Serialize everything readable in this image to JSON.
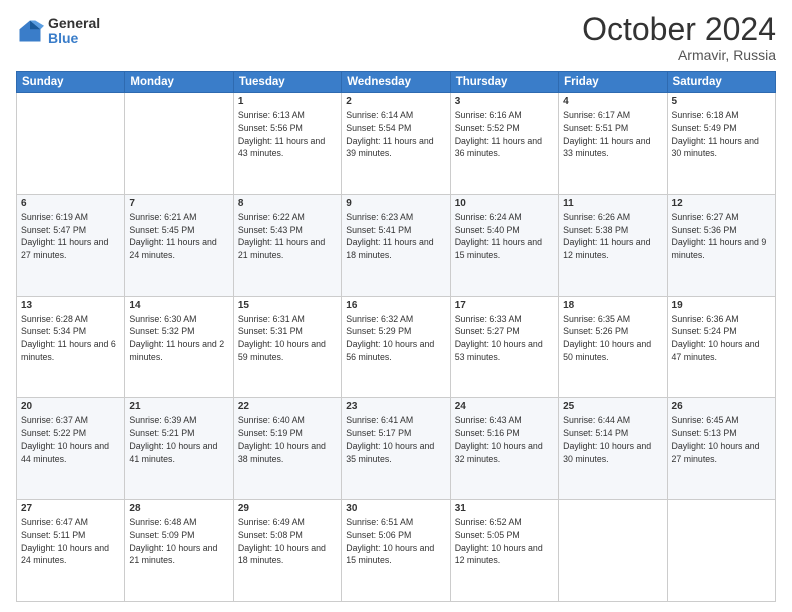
{
  "header": {
    "logo_general": "General",
    "logo_blue": "Blue",
    "month_title": "October 2024",
    "location": "Armavir, Russia"
  },
  "weekdays": [
    "Sunday",
    "Monday",
    "Tuesday",
    "Wednesday",
    "Thursday",
    "Friday",
    "Saturday"
  ],
  "weeks": [
    [
      {
        "day": null,
        "sunrise": null,
        "sunset": null,
        "daylight": null
      },
      {
        "day": null,
        "sunrise": null,
        "sunset": null,
        "daylight": null
      },
      {
        "day": "1",
        "sunrise": "Sunrise: 6:13 AM",
        "sunset": "Sunset: 5:56 PM",
        "daylight": "Daylight: 11 hours and 43 minutes."
      },
      {
        "day": "2",
        "sunrise": "Sunrise: 6:14 AM",
        "sunset": "Sunset: 5:54 PM",
        "daylight": "Daylight: 11 hours and 39 minutes."
      },
      {
        "day": "3",
        "sunrise": "Sunrise: 6:16 AM",
        "sunset": "Sunset: 5:52 PM",
        "daylight": "Daylight: 11 hours and 36 minutes."
      },
      {
        "day": "4",
        "sunrise": "Sunrise: 6:17 AM",
        "sunset": "Sunset: 5:51 PM",
        "daylight": "Daylight: 11 hours and 33 minutes."
      },
      {
        "day": "5",
        "sunrise": "Sunrise: 6:18 AM",
        "sunset": "Sunset: 5:49 PM",
        "daylight": "Daylight: 11 hours and 30 minutes."
      }
    ],
    [
      {
        "day": "6",
        "sunrise": "Sunrise: 6:19 AM",
        "sunset": "Sunset: 5:47 PM",
        "daylight": "Daylight: 11 hours and 27 minutes."
      },
      {
        "day": "7",
        "sunrise": "Sunrise: 6:21 AM",
        "sunset": "Sunset: 5:45 PM",
        "daylight": "Daylight: 11 hours and 24 minutes."
      },
      {
        "day": "8",
        "sunrise": "Sunrise: 6:22 AM",
        "sunset": "Sunset: 5:43 PM",
        "daylight": "Daylight: 11 hours and 21 minutes."
      },
      {
        "day": "9",
        "sunrise": "Sunrise: 6:23 AM",
        "sunset": "Sunset: 5:41 PM",
        "daylight": "Daylight: 11 hours and 18 minutes."
      },
      {
        "day": "10",
        "sunrise": "Sunrise: 6:24 AM",
        "sunset": "Sunset: 5:40 PM",
        "daylight": "Daylight: 11 hours and 15 minutes."
      },
      {
        "day": "11",
        "sunrise": "Sunrise: 6:26 AM",
        "sunset": "Sunset: 5:38 PM",
        "daylight": "Daylight: 11 hours and 12 minutes."
      },
      {
        "day": "12",
        "sunrise": "Sunrise: 6:27 AM",
        "sunset": "Sunset: 5:36 PM",
        "daylight": "Daylight: 11 hours and 9 minutes."
      }
    ],
    [
      {
        "day": "13",
        "sunrise": "Sunrise: 6:28 AM",
        "sunset": "Sunset: 5:34 PM",
        "daylight": "Daylight: 11 hours and 6 minutes."
      },
      {
        "day": "14",
        "sunrise": "Sunrise: 6:30 AM",
        "sunset": "Sunset: 5:32 PM",
        "daylight": "Daylight: 11 hours and 2 minutes."
      },
      {
        "day": "15",
        "sunrise": "Sunrise: 6:31 AM",
        "sunset": "Sunset: 5:31 PM",
        "daylight": "Daylight: 10 hours and 59 minutes."
      },
      {
        "day": "16",
        "sunrise": "Sunrise: 6:32 AM",
        "sunset": "Sunset: 5:29 PM",
        "daylight": "Daylight: 10 hours and 56 minutes."
      },
      {
        "day": "17",
        "sunrise": "Sunrise: 6:33 AM",
        "sunset": "Sunset: 5:27 PM",
        "daylight": "Daylight: 10 hours and 53 minutes."
      },
      {
        "day": "18",
        "sunrise": "Sunrise: 6:35 AM",
        "sunset": "Sunset: 5:26 PM",
        "daylight": "Daylight: 10 hours and 50 minutes."
      },
      {
        "day": "19",
        "sunrise": "Sunrise: 6:36 AM",
        "sunset": "Sunset: 5:24 PM",
        "daylight": "Daylight: 10 hours and 47 minutes."
      }
    ],
    [
      {
        "day": "20",
        "sunrise": "Sunrise: 6:37 AM",
        "sunset": "Sunset: 5:22 PM",
        "daylight": "Daylight: 10 hours and 44 minutes."
      },
      {
        "day": "21",
        "sunrise": "Sunrise: 6:39 AM",
        "sunset": "Sunset: 5:21 PM",
        "daylight": "Daylight: 10 hours and 41 minutes."
      },
      {
        "day": "22",
        "sunrise": "Sunrise: 6:40 AM",
        "sunset": "Sunset: 5:19 PM",
        "daylight": "Daylight: 10 hours and 38 minutes."
      },
      {
        "day": "23",
        "sunrise": "Sunrise: 6:41 AM",
        "sunset": "Sunset: 5:17 PM",
        "daylight": "Daylight: 10 hours and 35 minutes."
      },
      {
        "day": "24",
        "sunrise": "Sunrise: 6:43 AM",
        "sunset": "Sunset: 5:16 PM",
        "daylight": "Daylight: 10 hours and 32 minutes."
      },
      {
        "day": "25",
        "sunrise": "Sunrise: 6:44 AM",
        "sunset": "Sunset: 5:14 PM",
        "daylight": "Daylight: 10 hours and 30 minutes."
      },
      {
        "day": "26",
        "sunrise": "Sunrise: 6:45 AM",
        "sunset": "Sunset: 5:13 PM",
        "daylight": "Daylight: 10 hours and 27 minutes."
      }
    ],
    [
      {
        "day": "27",
        "sunrise": "Sunrise: 6:47 AM",
        "sunset": "Sunset: 5:11 PM",
        "daylight": "Daylight: 10 hours and 24 minutes."
      },
      {
        "day": "28",
        "sunrise": "Sunrise: 6:48 AM",
        "sunset": "Sunset: 5:09 PM",
        "daylight": "Daylight: 10 hours and 21 minutes."
      },
      {
        "day": "29",
        "sunrise": "Sunrise: 6:49 AM",
        "sunset": "Sunset: 5:08 PM",
        "daylight": "Daylight: 10 hours and 18 minutes."
      },
      {
        "day": "30",
        "sunrise": "Sunrise: 6:51 AM",
        "sunset": "Sunset: 5:06 PM",
        "daylight": "Daylight: 10 hours and 15 minutes."
      },
      {
        "day": "31",
        "sunrise": "Sunrise: 6:52 AM",
        "sunset": "Sunset: 5:05 PM",
        "daylight": "Daylight: 10 hours and 12 minutes."
      },
      {
        "day": null,
        "sunrise": null,
        "sunset": null,
        "daylight": null
      },
      {
        "day": null,
        "sunrise": null,
        "sunset": null,
        "daylight": null
      }
    ]
  ]
}
